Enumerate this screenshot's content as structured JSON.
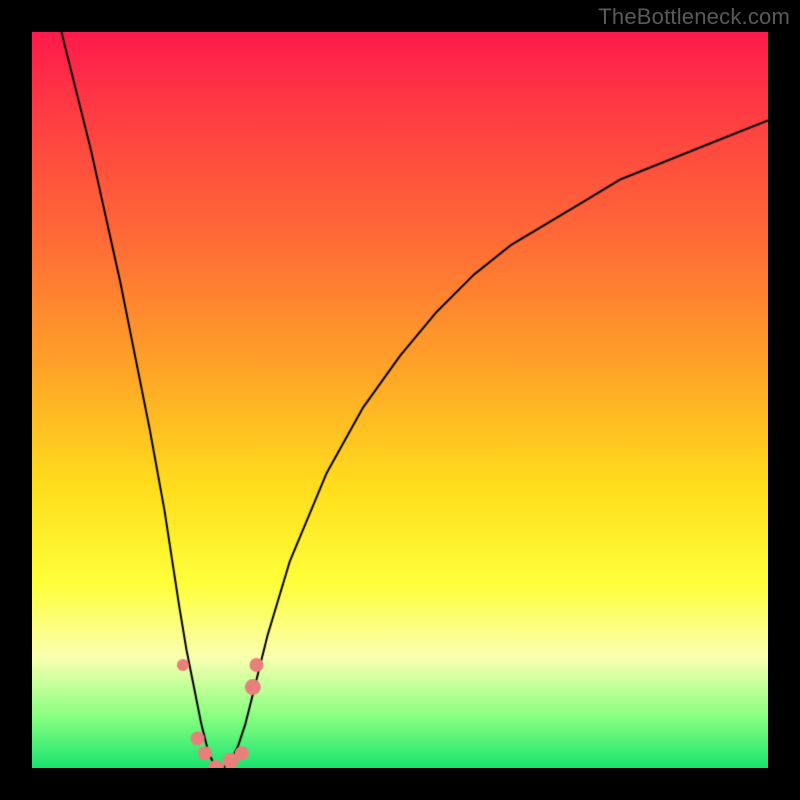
{
  "watermark": "TheBottleneck.com",
  "chart_data": {
    "type": "line",
    "title": "",
    "xlabel": "",
    "ylabel": "",
    "xlim": [
      0,
      100
    ],
    "ylim": [
      0,
      100
    ],
    "optimum_x": 25,
    "green_band_top_y": 8,
    "series": [
      {
        "name": "bottleneck-curve",
        "color": "#000000",
        "x": [
          4,
          6,
          8,
          10,
          12,
          14,
          16,
          18,
          20,
          21,
          22,
          23,
          24,
          25,
          26,
          27,
          28,
          29,
          30,
          32,
          35,
          40,
          45,
          50,
          55,
          60,
          65,
          70,
          75,
          80,
          85,
          90,
          95,
          100
        ],
        "y": [
          100,
          92,
          84,
          75,
          66,
          56,
          46,
          35,
          22,
          16,
          11,
          6,
          2,
          0,
          0,
          1,
          3,
          6,
          10,
          18,
          28,
          40,
          49,
          56,
          62,
          67,
          71,
          74,
          77,
          80,
          82,
          84,
          86,
          88
        ]
      }
    ],
    "markers": [
      {
        "name": "left-edge-dot",
        "x": 20.5,
        "y": 14,
        "r": 6,
        "color": "#e97f7a"
      },
      {
        "name": "trough-dot-1",
        "x": 22.5,
        "y": 4,
        "r": 7,
        "color": "#e97f7a"
      },
      {
        "name": "trough-dot-2",
        "x": 23.5,
        "y": 2,
        "r": 7,
        "color": "#e97f7a"
      },
      {
        "name": "trough-dot-3",
        "x": 25.0,
        "y": 0,
        "r": 8,
        "color": "#e97f7a"
      },
      {
        "name": "trough-dot-4",
        "x": 27.0,
        "y": 1,
        "r": 8,
        "color": "#e97f7a"
      },
      {
        "name": "trough-dot-5",
        "x": 28.5,
        "y": 2,
        "r": 7,
        "color": "#e97f7a"
      },
      {
        "name": "right-edge-dot-1",
        "x": 30.0,
        "y": 11,
        "r": 8,
        "color": "#e97f7a"
      },
      {
        "name": "right-edge-dot-2",
        "x": 30.5,
        "y": 14,
        "r": 7,
        "color": "#e97f7a"
      }
    ]
  }
}
